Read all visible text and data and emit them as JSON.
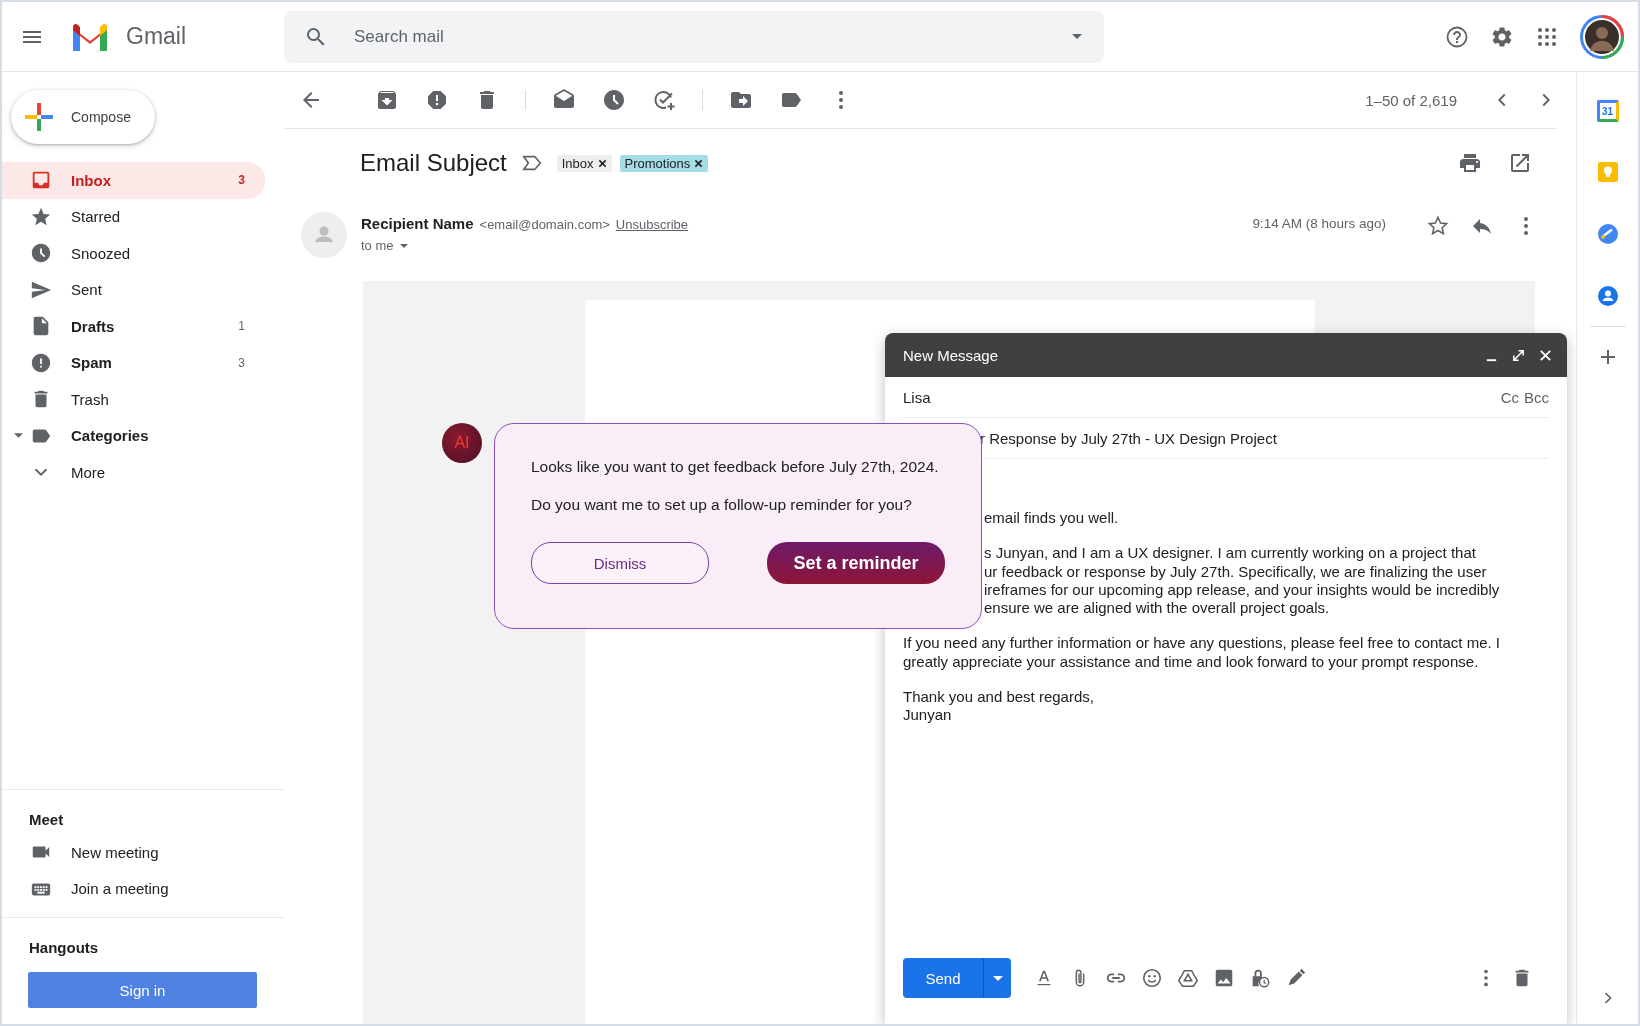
{
  "app": {
    "name": "Gmail"
  },
  "search": {
    "placeholder": "Search mail"
  },
  "compose_button": "Compose",
  "nav": [
    {
      "label": "Inbox",
      "count": "3",
      "bold": true,
      "selected": true,
      "kind": "folder"
    },
    {
      "label": "Starred",
      "bold": false,
      "selected": false,
      "kind": "folder"
    },
    {
      "label": "Snoozed",
      "bold": false,
      "selected": false,
      "kind": "folder"
    },
    {
      "label": "Sent",
      "bold": false,
      "selected": false,
      "kind": "folder"
    },
    {
      "label": "Drafts",
      "count": "1",
      "bold": true,
      "selected": false,
      "kind": "folder"
    },
    {
      "label": "Spam",
      "count": "3",
      "bold": true,
      "selected": false,
      "kind": "folder"
    },
    {
      "label": "Trash",
      "bold": false,
      "selected": false,
      "kind": "folder"
    },
    {
      "label": "Categories",
      "bold": true,
      "selected": false,
      "kind": "group"
    },
    {
      "label": "More",
      "bold": false,
      "selected": false,
      "kind": "more"
    }
  ],
  "meet": {
    "title": "Meet",
    "items": [
      "New meeting",
      "Join a meeting"
    ]
  },
  "hangouts": {
    "title": "Hangouts",
    "button": "Sign in"
  },
  "pagination": "1–50 of 2,619",
  "email": {
    "subject": "Email Subject",
    "labels": [
      {
        "text": "Inbox",
        "color": "#eeeeee"
      },
      {
        "text": "Promotions",
        "color": "#a4dde6"
      }
    ],
    "sender_name": "Recipient Name",
    "sender_address": "<email@domain.com>",
    "unsubscribe": "Unsubscribe",
    "to": "to me",
    "time": "9:14 AM (8 hours ago)"
  },
  "rail": {
    "calendar_day": "31"
  },
  "compose": {
    "title": "New Message",
    "to": "Lisa",
    "cc": "Cc",
    "bcc": "Bcc",
    "subject": "r Response by July 27th - UX Design Project",
    "paragraphs": [
      [
        {
          "text": "email finds you well.",
          "covered": true
        }
      ],
      [
        {
          "text": "s Junyan, and I am a UX designer. I am currently working on a project that",
          "covered": true
        },
        {
          "text": "ur feedback or response by July 27th. Specifically, we are finalizing the user",
          "covered": true
        },
        {
          "text": "ireframes for our upcoming app release, and your insights would be incredibly",
          "covered": true
        },
        {
          "text": "ensure we are aligned with the overall project goals.",
          "covered": true
        }
      ],
      [
        {
          "text": "If you need any further information or have any questions, please feel free to contact me. I",
          "covered": false
        },
        {
          "text": "greatly appreciate your assistance and time and look forward to your prompt response.",
          "covered": false
        }
      ],
      [
        {
          "text": "Thank you and best regards,",
          "covered": false
        },
        {
          "text": "Junyan",
          "covered": false
        }
      ]
    ],
    "send": "Send"
  },
  "ai_popup": {
    "avatar": "AI",
    "lines": [
      "Looks like you want to get feedback before July 27th, 2024.",
      "Do you want me to set up a follow-up reminder for you?"
    ],
    "buttons": [
      {
        "label": "Dismiss",
        "kind": "secondary"
      },
      {
        "label": "Set a reminder",
        "kind": "primary"
      }
    ]
  }
}
